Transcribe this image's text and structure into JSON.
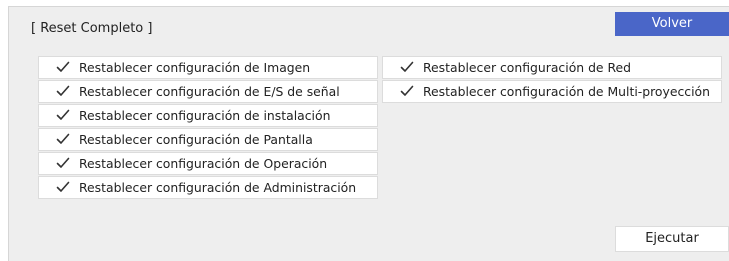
{
  "header": {
    "title": "[ Reset Completo ]",
    "back_label": "Volver"
  },
  "options_left": [
    {
      "label": "Restablecer configuración de Imagen",
      "checked": true
    },
    {
      "label": "Restablecer configuración de E/S de señal",
      "checked": true
    },
    {
      "label": "Restablecer configuración de instalación",
      "checked": true
    },
    {
      "label": "Restablecer configuración de Pantalla",
      "checked": true
    },
    {
      "label": "Restablecer configuración de Operación",
      "checked": true
    },
    {
      "label": "Restablecer configuración de Administración",
      "checked": true
    }
  ],
  "options_right": [
    {
      "label": "Restablecer configuración de Red",
      "checked": true
    },
    {
      "label": "Restablecer configuración de Multi-proyección",
      "checked": true
    }
  ],
  "footer": {
    "execute_label": "Ejecutar"
  },
  "colors": {
    "accent": "#4a66c8",
    "panel_bg": "#eeeeee",
    "item_bg": "#ffffff"
  },
  "icons": {
    "check": "check-icon"
  }
}
